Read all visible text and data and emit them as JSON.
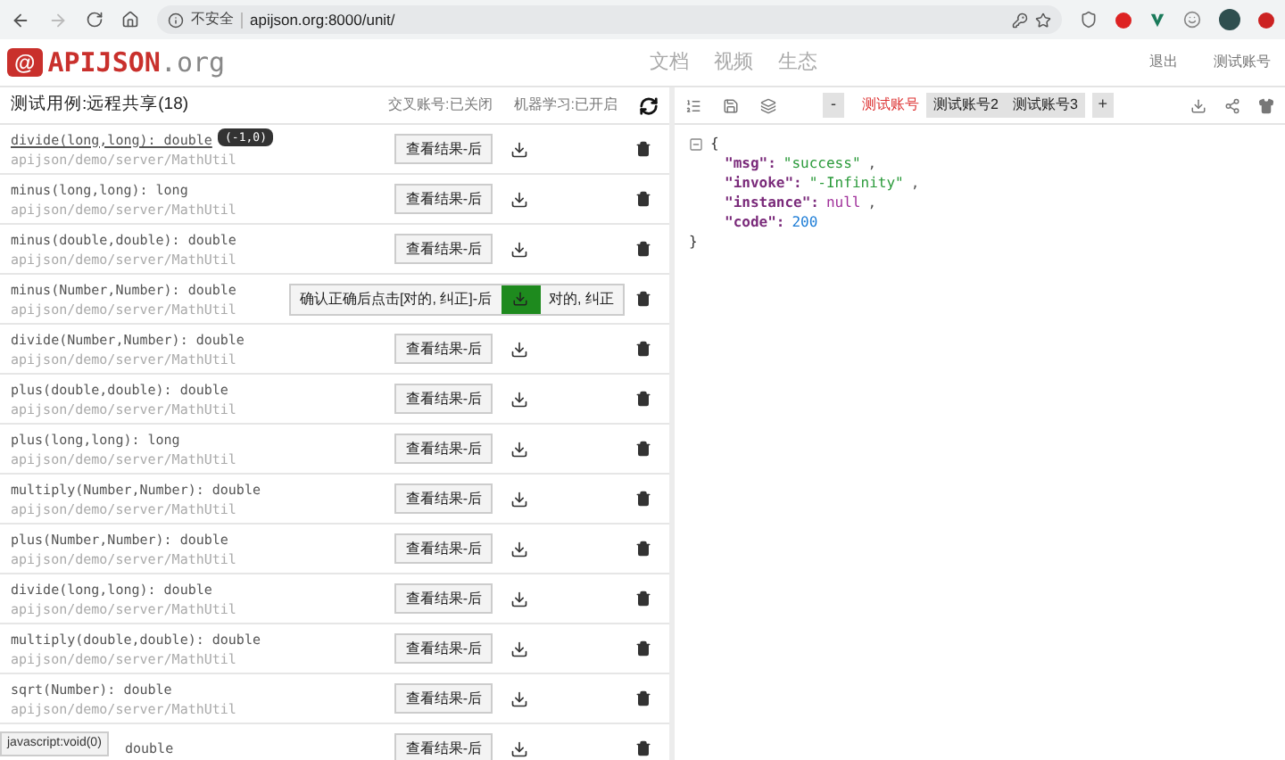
{
  "browser": {
    "security_label": "不安全",
    "url": "apijson.org:8000/unit/"
  },
  "header": {
    "logo_mark": "@",
    "logo_name": "APIJSON",
    "logo_suffix": ".org",
    "nav": [
      "文档",
      "视频",
      "生态"
    ],
    "actions": [
      "退出",
      "测试账号"
    ]
  },
  "left_panel": {
    "title": "测试用例:远程共享(18)",
    "cross_account": "交叉账号:已关闭",
    "machine_learning": "机器学习:已开启",
    "rows": [
      {
        "kind": "normal",
        "signature": "divide(long,long): double",
        "path": "apijson/demo/server/MathUtil",
        "button": "查看结果-后",
        "tooltip": "(-1,0)"
      },
      {
        "kind": "normal",
        "signature": "minus(long,long): long",
        "path": "apijson/demo/server/MathUtil",
        "button": "查看结果-后"
      },
      {
        "kind": "normal",
        "signature": "minus(double,double): double",
        "path": "apijson/demo/server/MathUtil",
        "button": "查看结果-后"
      },
      {
        "kind": "confirm",
        "signature": "minus(Number,Number): double",
        "path": "apijson/demo/server/MathUtil",
        "button": "确认正确后点击[对的, 纠正]-后",
        "correct": "对的, 纠正"
      },
      {
        "kind": "normal",
        "signature": "divide(Number,Number): double",
        "path": "apijson/demo/server/MathUtil",
        "button": "查看结果-后"
      },
      {
        "kind": "normal",
        "signature": "plus(double,double): double",
        "path": "apijson/demo/server/MathUtil",
        "button": "查看结果-后"
      },
      {
        "kind": "normal",
        "signature": "plus(long,long): long",
        "path": "apijson/demo/server/MathUtil",
        "button": "查看结果-后"
      },
      {
        "kind": "normal",
        "signature": "multiply(Number,Number): double",
        "path": "apijson/demo/server/MathUtil",
        "button": "查看结果-后"
      },
      {
        "kind": "normal",
        "signature": "plus(Number,Number): double",
        "path": "apijson/demo/server/MathUtil",
        "button": "查看结果-后"
      },
      {
        "kind": "normal",
        "signature": "divide(long,long): double",
        "path": "apijson/demo/server/MathUtil",
        "button": "查看结果-后"
      },
      {
        "kind": "normal",
        "signature": "multiply(double,double): double",
        "path": "apijson/demo/server/MathUtil",
        "button": "查看结果-后"
      },
      {
        "kind": "normal",
        "signature": "sqrt(Number): double",
        "path": "apijson/demo/server/MathUtil",
        "button": "查看结果-后"
      },
      {
        "kind": "covered",
        "signature": "double",
        "button": "查看结果-后"
      }
    ]
  },
  "right_panel": {
    "minus": "-",
    "plus": "+",
    "accounts": [
      {
        "label": "测试账号",
        "selected": true
      },
      {
        "label": "测试账号2",
        "selected": false
      },
      {
        "label": "测试账号3",
        "selected": false
      }
    ],
    "json_view": {
      "open": "{",
      "close": "}",
      "entries": [
        {
          "key": "\"msg\":",
          "value": "\"success\"",
          "kind": "string",
          "sep": ","
        },
        {
          "key": "\"invoke\":",
          "value": "\"-Infinity\"",
          "kind": "string",
          "sep": ","
        },
        {
          "key": "\"instance\":",
          "value": "null",
          "kind": "null",
          "sep": ","
        },
        {
          "key": "\"code\":",
          "value": "200",
          "kind": "number"
        }
      ]
    }
  },
  "status_bar": "javascript:void(0)"
}
